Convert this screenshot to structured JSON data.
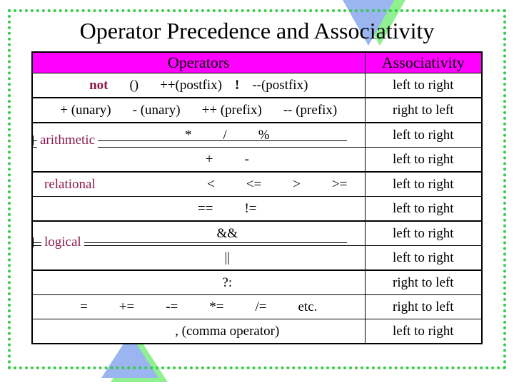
{
  "slide": {
    "title": "Operator Precedence and Associativity",
    "border_color": "#33cc44",
    "header_fill": "#ff00ff",
    "accent_text_color": "#8b1a4a",
    "triangle_blue": "#9bb5f0",
    "triangle_green": "#8ef08e"
  },
  "table": {
    "headers": {
      "operators": "Operators",
      "associativity": "Associativity"
    },
    "group_labels": {
      "arithmetic": "arithmetic",
      "relational": "relational",
      "logical": "logical"
    },
    "rows": [
      {
        "id": "row-postfix",
        "keyword": "not",
        "ops": [
          "()",
          "++(postfix)",
          "!",
          "--(postfix)"
        ],
        "ops_text": "not   ()    ++(postfix)  !  --(postfix)",
        "assoc": "left to right"
      },
      {
        "id": "row-unary",
        "ops": [
          "+ (unary)",
          "- (unary)",
          "++ (prefix)",
          "-- (prefix)"
        ],
        "ops_text": "+ (unary)   - (unary)   ++ (prefix)   -- (prefix)",
        "assoc": "right to left"
      },
      {
        "id": "row-multiplicative",
        "ops": [
          "*",
          "/",
          "%"
        ],
        "ops_text": "*     /     %",
        "assoc": "left to right"
      },
      {
        "id": "row-additive",
        "ops": [
          "+",
          "-"
        ],
        "ops_text": "+     -",
        "assoc": "left to right"
      },
      {
        "id": "row-relational",
        "ops": [
          "<",
          "<=",
          ">",
          ">="
        ],
        "ops_text": "<      <=      >      >=",
        "assoc": "left to right"
      },
      {
        "id": "row-equality",
        "ops": [
          "==",
          "!="
        ],
        "ops_text": "==      !=",
        "assoc": "left to right"
      },
      {
        "id": "row-logical-and",
        "ops": [
          "&&"
        ],
        "ops_text": "&&",
        "assoc": "left to right"
      },
      {
        "id": "row-logical-or",
        "ops": [
          "||"
        ],
        "ops_text": "||",
        "assoc": "left to right"
      },
      {
        "id": "row-conditional",
        "ops": [
          "?:"
        ],
        "ops_text": "?:",
        "assoc": "right to left"
      },
      {
        "id": "row-assignment",
        "ops": [
          "=",
          "+=",
          "-=",
          "*=",
          "/=",
          "etc."
        ],
        "ops_text": "=     +=     -=     *=     /=      etc.",
        "assoc": "right to left"
      },
      {
        "id": "row-comma",
        "ops": [
          ",",
          "(comma operator)"
        ],
        "ops_text": ",  (comma operator)",
        "assoc": "left to right"
      }
    ]
  }
}
